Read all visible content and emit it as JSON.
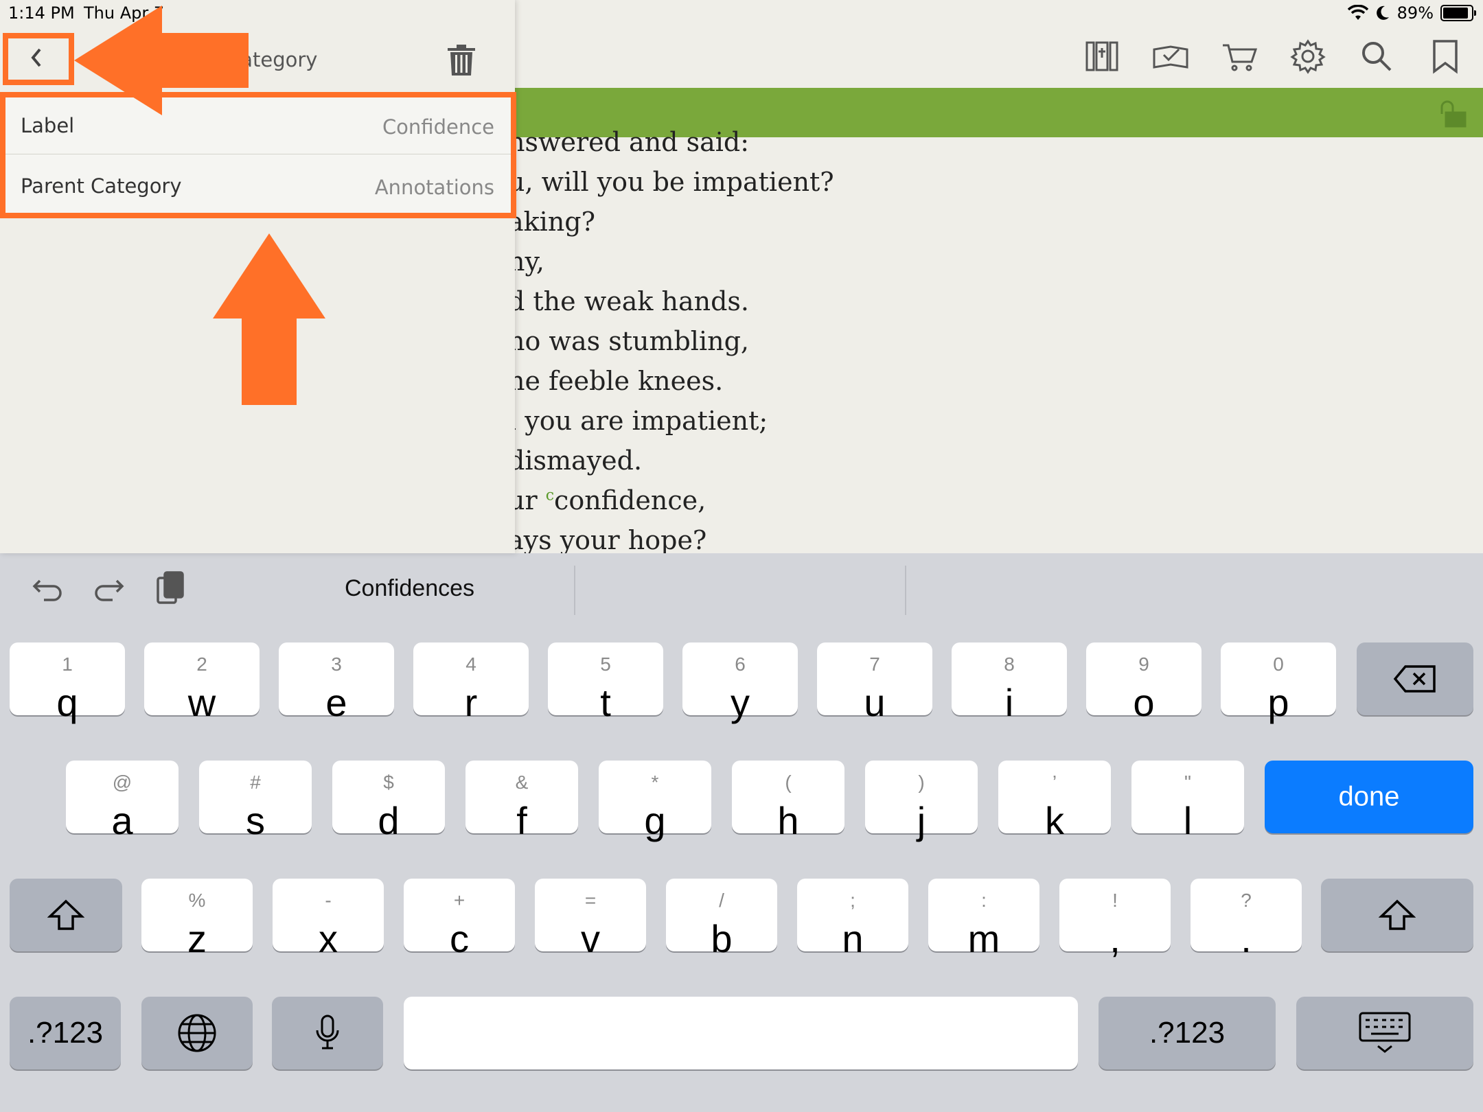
{
  "status": {
    "time": "1:14 PM",
    "date": "Thu Apr 7",
    "battery": "89%",
    "battery_level": 0.89
  },
  "toolbar_icons": [
    "library-icon",
    "reading-plans-icon",
    "cart-icon",
    "gear-icon",
    "search-icon",
    "bookmark-icon"
  ],
  "reader": {
    "lines": [
      "nswered and said:",
      "u, will you be impatient?",
      "aking?",
      "ny,",
      "d the weak hands.",
      "no was stumbling,",
      "he feeble knees.",
      "l you are impatient;",
      " dismayed."
    ],
    "line_confidence_pre": "ur ",
    "footnote": "c",
    "line_confidence_post": "confidence,",
    "last_line": "ays your hope?"
  },
  "panel": {
    "title": "Category",
    "label_field": {
      "label": "Label",
      "value": "Confidence"
    },
    "parent_field": {
      "label": "Parent Category",
      "value": "Annotations"
    }
  },
  "keyboard": {
    "suggestion": "Confidences",
    "row1": [
      {
        "k": "q",
        "a": "1"
      },
      {
        "k": "w",
        "a": "2"
      },
      {
        "k": "e",
        "a": "3"
      },
      {
        "k": "r",
        "a": "4"
      },
      {
        "k": "t",
        "a": "5"
      },
      {
        "k": "y",
        "a": "6"
      },
      {
        "k": "u",
        "a": "7"
      },
      {
        "k": "i",
        "a": "8"
      },
      {
        "k": "o",
        "a": "9"
      },
      {
        "k": "p",
        "a": "0"
      }
    ],
    "row2": [
      {
        "k": "a",
        "a": "@"
      },
      {
        "k": "s",
        "a": "#"
      },
      {
        "k": "d",
        "a": "$"
      },
      {
        "k": "f",
        "a": "&"
      },
      {
        "k": "g",
        "a": "*"
      },
      {
        "k": "h",
        "a": "("
      },
      {
        "k": "j",
        "a": ")"
      },
      {
        "k": "k",
        "a": "’"
      },
      {
        "k": "l",
        "a": "\""
      }
    ],
    "row3": [
      {
        "k": "z",
        "a": "%"
      },
      {
        "k": "x",
        "a": "-"
      },
      {
        "k": "c",
        "a": "+"
      },
      {
        "k": "v",
        "a": "="
      },
      {
        "k": "b",
        "a": "/"
      },
      {
        "k": "n",
        "a": ";"
      },
      {
        "k": "m",
        "a": ":"
      },
      {
        "k": ",",
        "a": "!"
      },
      {
        "k": ".",
        "a": "?"
      }
    ],
    "done_label": "done",
    "numbers_label": ".?123"
  },
  "annotation_color": "#ff7028",
  "accent_green": "#7aa83b",
  "accent_blue": "#0b7cff"
}
